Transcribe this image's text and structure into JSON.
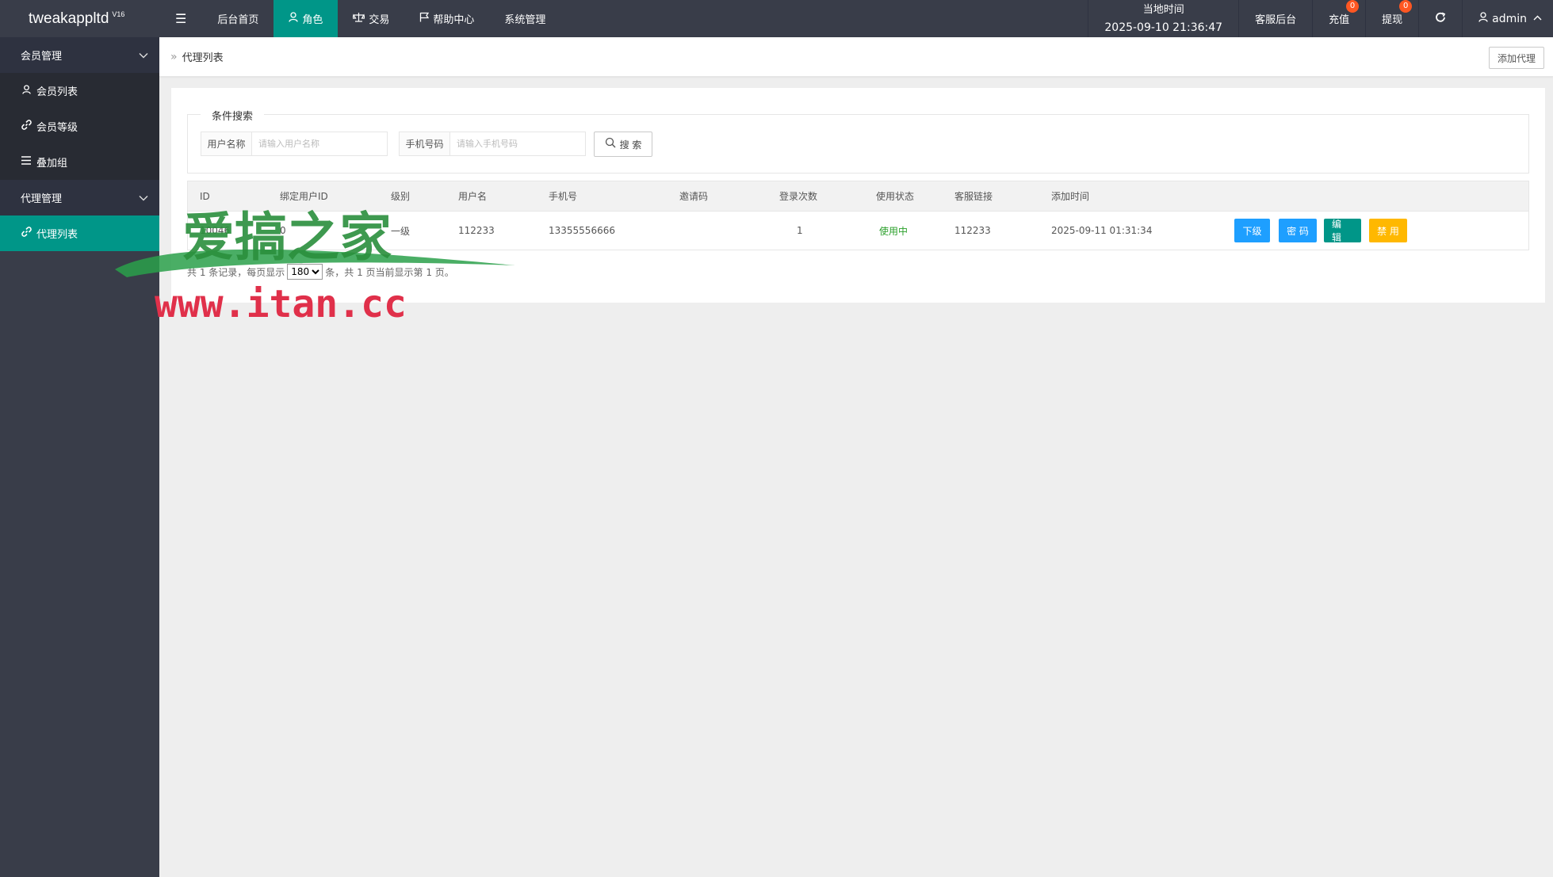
{
  "app": {
    "title": "tweakappltd",
    "version": "V16"
  },
  "topnav": {
    "menu_icon": "menu-icon",
    "items": [
      {
        "label": "后台首页",
        "icon": ""
      },
      {
        "label": "角色",
        "icon": "user-icon",
        "active": true
      },
      {
        "label": "交易",
        "icon": "scale-icon"
      },
      {
        "label": "帮助中心",
        "icon": "flag-icon"
      },
      {
        "label": "系统管理",
        "icon": ""
      }
    ]
  },
  "topright": {
    "time_label": "当地时间",
    "time_value": "2025-09-10 21:36:47",
    "service": "客服后台",
    "recharge": "充值",
    "recharge_badge": "0",
    "withdraw": "提现",
    "withdraw_badge": "0",
    "user": "admin"
  },
  "sidebar": {
    "groups": [
      {
        "label": "会员管理",
        "items": [
          {
            "label": "会员列表",
            "icon": "user-icon"
          },
          {
            "label": "会员等级",
            "icon": "link-icon"
          },
          {
            "label": "叠加组",
            "icon": "list-icon"
          }
        ]
      },
      {
        "label": "代理管理",
        "items": [
          {
            "label": "代理列表",
            "icon": "link-icon",
            "active": true
          }
        ]
      }
    ]
  },
  "breadcrumb": {
    "current": "代理列表"
  },
  "add_button": "添加代理",
  "search": {
    "legend": "条件搜索",
    "username_label": "用户名称",
    "username_placeholder": "请输入用户名称",
    "phone_label": "手机号码",
    "phone_placeholder": "请输入手机号码",
    "button": "搜 索"
  },
  "table": {
    "headers": [
      "ID",
      "绑定用户ID",
      "级别",
      "用户名",
      "手机号",
      "邀请码",
      "登录次数",
      "使用状态",
      "客服链接",
      "添加时间"
    ],
    "rows": [
      {
        "id": "10046",
        "bind_user_id": "0",
        "level": "一级",
        "username": "112233",
        "phone": "13355556666",
        "invite_code": "",
        "login_count": "1",
        "status": "使用中",
        "service_link": "112233",
        "created": "2025-09-11 01:31:34",
        "actions": [
          "下级",
          "密 码",
          "编 辑",
          "禁 用"
        ]
      }
    ]
  },
  "pager": {
    "prefix": "共 1 条记录，每页显示",
    "page_size": "180",
    "suffix": "条，共 1 页当前显示第 1 页。"
  },
  "watermark": {
    "line1": "爱搞之家",
    "line2": "www.itan.cc"
  },
  "colors": {
    "header_bg": "#393d49",
    "accent": "#009688",
    "blue": "#1e9fff",
    "orange": "#ffb800",
    "badge": "#ff5722"
  }
}
